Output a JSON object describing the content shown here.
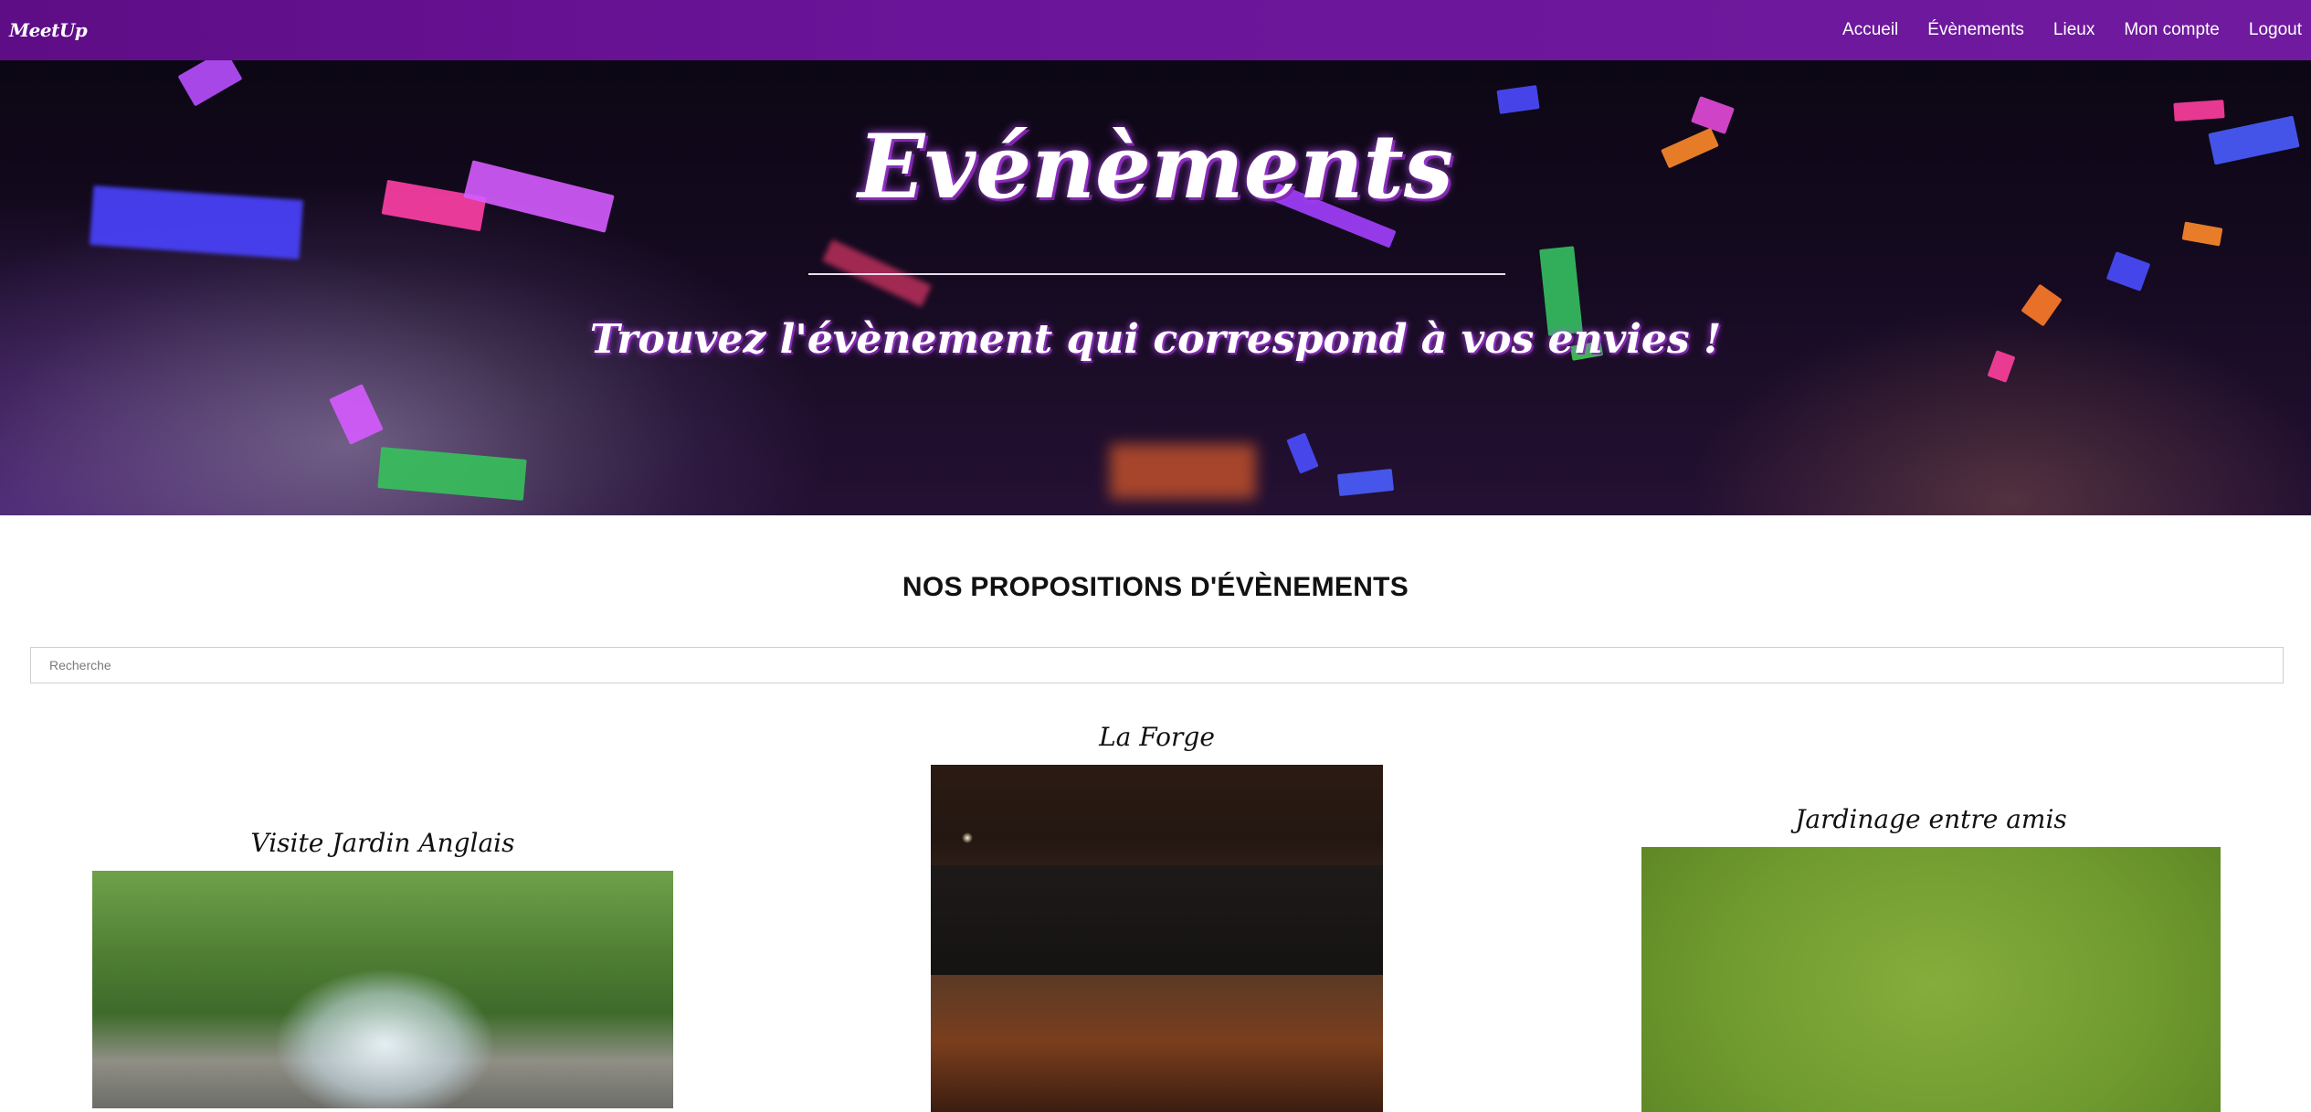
{
  "navbar": {
    "brand": "MeetUp",
    "links": [
      "Accueil",
      "Évènements",
      "Lieux",
      "Mon compte",
      "Logout"
    ]
  },
  "hero": {
    "title": "Evénèments",
    "subtitle": "Trouvez l'évènement qui correspond à vos envies !"
  },
  "section": {
    "title": "NOS PROPOSITIONS D'ÉVÈNEMENTS",
    "search_placeholder": "Recherche"
  },
  "cards": [
    {
      "title": "Visite Jardin Anglais",
      "image": "park-fountain-photo"
    },
    {
      "title": "La Forge",
      "image": "bar-interior-photo"
    },
    {
      "title": "Jardinage entre amis",
      "image": "garden-lawn-photo"
    }
  ],
  "colors": {
    "navbar": "#6a1499",
    "hero_glow": "#be50ff"
  }
}
